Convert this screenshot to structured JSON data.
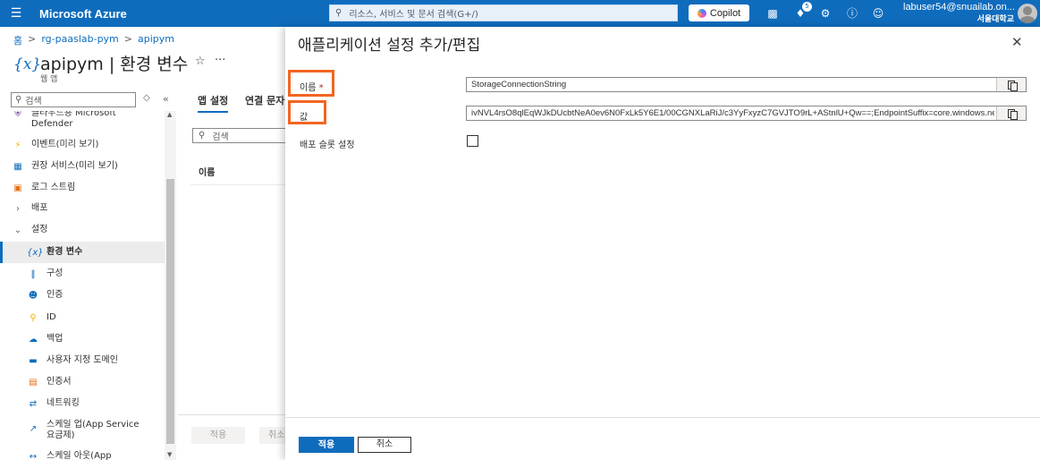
{
  "topbar": {
    "menu_icon": "hamburger-icon",
    "brand": "Microsoft Azure",
    "search_placeholder": "리소스, 서비스 및 문서 검색(G+/)",
    "copilot_label": "Copilot",
    "notification_count": "5",
    "user_name": "labuser54@snuailab.on...",
    "user_org": "서울대학교"
  },
  "breadcrumb": [
    "홈",
    "rg-paaslab-pym",
    "apipym"
  ],
  "resource": {
    "icon_text": "{x}",
    "title": "apipym | 환경 변수",
    "subtitle": "웹 앱"
  },
  "sidebar": {
    "search_placeholder": "검색",
    "items": [
      {
        "label": "클라우드용 Microsoft Defender",
        "icon": "shield-icon",
        "color": "#5c2e91"
      },
      {
        "label": "이벤트(미리 보기)",
        "icon": "lightning-icon",
        "color": "#f2b200"
      },
      {
        "label": "권장 서비스(미리 보기)",
        "icon": "grid-icon",
        "color": "#0f6cbd"
      },
      {
        "label": "로그 스트림",
        "icon": "log-stream-icon",
        "color": "#e86d12"
      },
      {
        "label": "배포",
        "icon": "chevron-right-icon",
        "color": "#605e5c"
      },
      {
        "label": "설정",
        "icon": "chevron-down-icon",
        "color": "#605e5c"
      },
      {
        "label": "환경 변수",
        "icon": "variable-icon",
        "color": "#0f6cbd"
      },
      {
        "label": "구성",
        "icon": "sliders-icon",
        "color": "#0f6cbd"
      },
      {
        "label": "인증",
        "icon": "person-key-icon",
        "color": "#0f6cbd"
      },
      {
        "label": "ID",
        "icon": "key-icon",
        "color": "#f2b200"
      },
      {
        "label": "백업",
        "icon": "cloud-icon",
        "color": "#0f6cbd"
      },
      {
        "label": "사용자 지정 도메인",
        "icon": "domain-icon",
        "color": "#0f6cbd"
      },
      {
        "label": "인증서",
        "icon": "certificate-icon",
        "color": "#e86d12"
      },
      {
        "label": "네트워킹",
        "icon": "network-icon",
        "color": "#0f6cbd"
      },
      {
        "label": "스케일 업(App Service 요금제)",
        "icon": "scale-up-icon",
        "color": "#0f6cbd"
      },
      {
        "label": "스케일 아웃(App",
        "icon": "scale-out-icon",
        "color": "#0f6cbd"
      }
    ]
  },
  "main": {
    "tabs": [
      "앱 설정",
      "연결 문자"
    ],
    "search_placeholder": "검색",
    "column_name": "이름",
    "apply_label": "적용",
    "cancel_label": "취소"
  },
  "panel": {
    "title": "애플리케이션 설정 추가/편집",
    "name_label": "이름",
    "required_mark": "*",
    "value_label": "값",
    "slot_label": "배포 슬롯 설정",
    "name_value": "StorageConnectionString",
    "value_value": "ivNVL4rsO8qlEqWJkDUcbtNeA0ev6N0FxLk5Y6E1/00CGNXLaRiJ/c3YyFxyzC7GVJTO9rL+AStnlU+Qw==;EndpointSuffix=core.windows.net",
    "slot_checked": false,
    "apply_label": "적용",
    "cancel_label": "취소"
  },
  "colors": {
    "accent": "#0f6cbd",
    "highlight": "#f26522"
  }
}
